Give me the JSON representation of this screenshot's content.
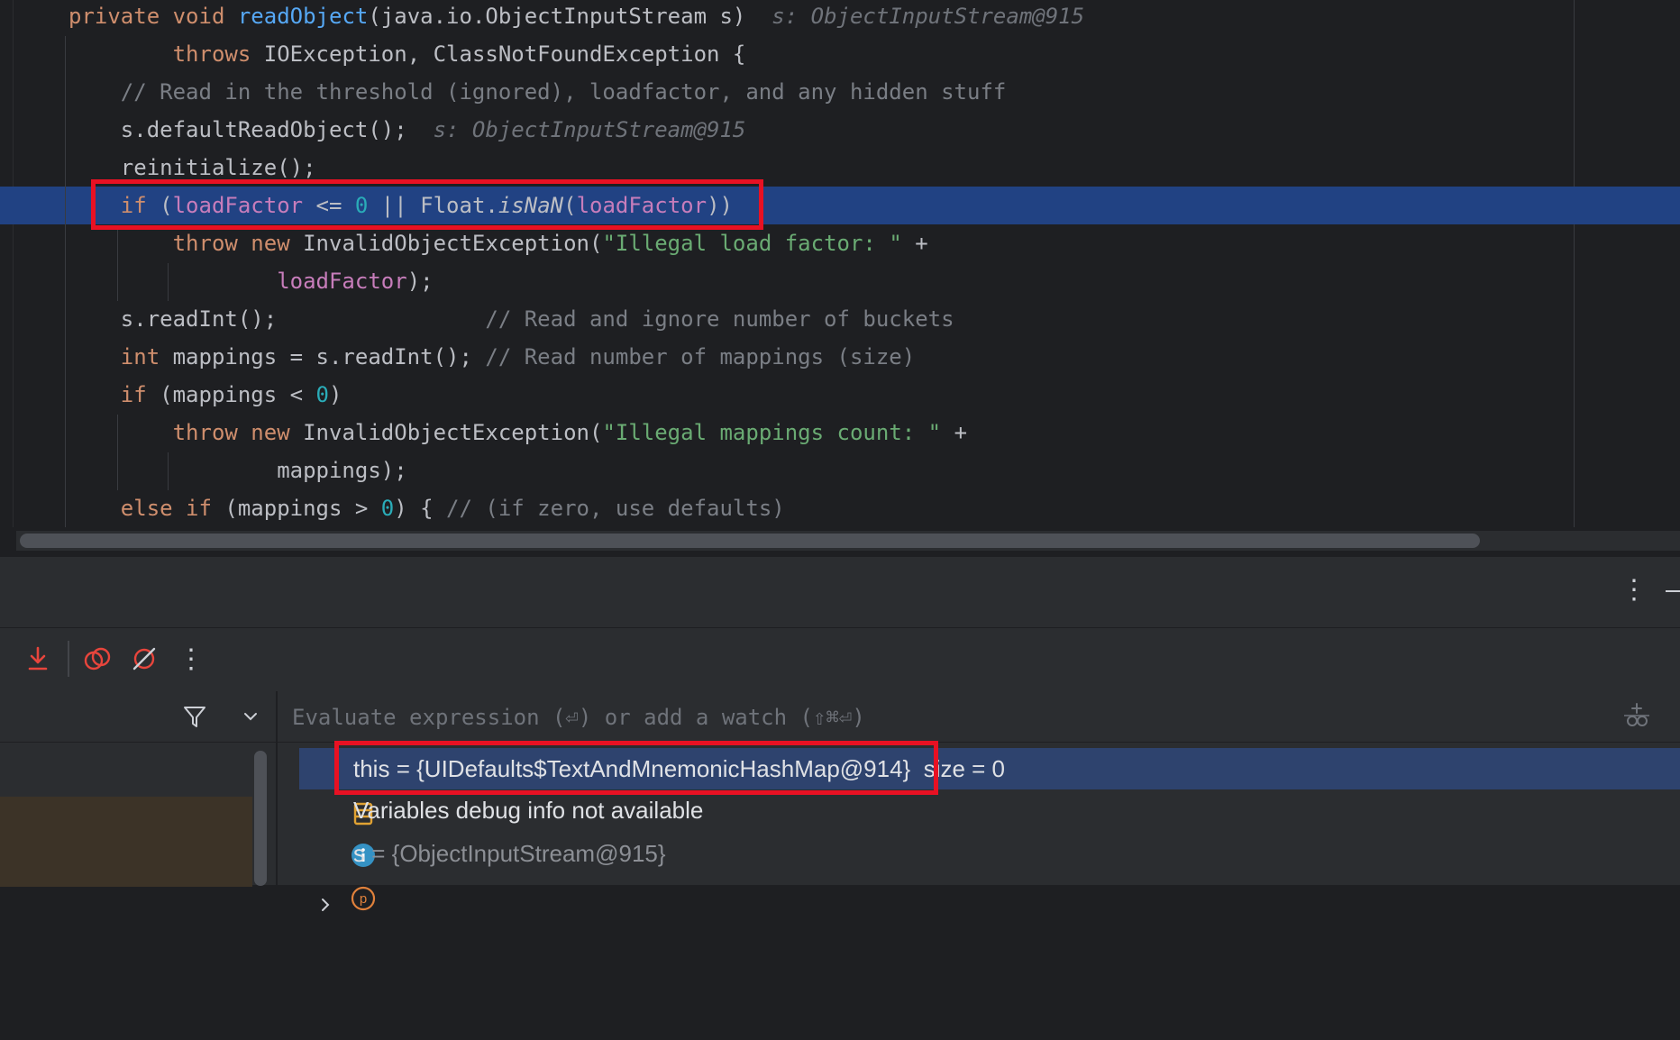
{
  "editor": {
    "lines": [
      {
        "segments": [
          {
            "t": "private void ",
            "c": "kw"
          },
          {
            "t": "readObject",
            "c": "fn"
          },
          {
            "t": "(java.io.ObjectInputStream s)  ",
            "c": ""
          },
          {
            "t": "s: ObjectInputStream@915",
            "c": "hint"
          }
        ]
      },
      {
        "segments": [
          {
            "t": "        throws ",
            "c": "kw"
          },
          {
            "t": "IOException, ClassNotFoundException {",
            "c": ""
          }
        ]
      },
      {
        "segments": [
          {
            "t": "    // Read in the threshold (ignored), loadfactor, and any hidden stuff",
            "c": "cm"
          }
        ]
      },
      {
        "segments": [
          {
            "t": "    s.defaultReadObject();  ",
            "c": ""
          },
          {
            "t": "s: ObjectInputStream@915",
            "c": "hint"
          }
        ]
      },
      {
        "segments": [
          {
            "t": "    reinitialize();",
            "c": ""
          }
        ]
      },
      {
        "segments": [
          {
            "t": "    if ",
            "c": "kw"
          },
          {
            "t": "(",
            "c": ""
          },
          {
            "t": "loadFactor",
            "c": "fld"
          },
          {
            "t": " <= ",
            "c": ""
          },
          {
            "t": "0",
            "c": "num"
          },
          {
            "t": " || Float.",
            "c": ""
          },
          {
            "t": "isNaN",
            "c": "stat"
          },
          {
            "t": "(",
            "c": ""
          },
          {
            "t": "loadFactor",
            "c": "fld"
          },
          {
            "t": "))",
            "c": ""
          }
        ]
      },
      {
        "segments": [
          {
            "t": "        throw new ",
            "c": "kw"
          },
          {
            "t": "InvalidObjectException(",
            "c": ""
          },
          {
            "t": "\"Illegal load factor: \"",
            "c": "str"
          },
          {
            "t": " +",
            "c": ""
          }
        ]
      },
      {
        "segments": [
          {
            "t": "                ",
            "c": ""
          },
          {
            "t": "loadFactor",
            "c": "fld"
          },
          {
            "t": ");",
            "c": ""
          }
        ]
      },
      {
        "segments": [
          {
            "t": "    s.readInt();                ",
            "c": ""
          },
          {
            "t": "// Read and ignore number of buckets",
            "c": "cm"
          }
        ]
      },
      {
        "segments": [
          {
            "t": "    int ",
            "c": "kw"
          },
          {
            "t": "mappings = s.readInt(); ",
            "c": ""
          },
          {
            "t": "// Read number of mappings (size)",
            "c": "cm"
          }
        ]
      },
      {
        "segments": [
          {
            "t": "    if ",
            "c": "kw"
          },
          {
            "t": "(mappings < ",
            "c": ""
          },
          {
            "t": "0",
            "c": "num"
          },
          {
            "t": ")",
            "c": ""
          }
        ]
      },
      {
        "segments": [
          {
            "t": "        throw new ",
            "c": "kw"
          },
          {
            "t": "InvalidObjectException(",
            "c": ""
          },
          {
            "t": "\"Illegal mappings count: \"",
            "c": "str"
          },
          {
            "t": " +",
            "c": ""
          }
        ]
      },
      {
        "segments": [
          {
            "t": "                mappings);",
            "c": ""
          }
        ]
      },
      {
        "segments": [
          {
            "t": "    else if ",
            "c": "kw"
          },
          {
            "t": "(mappings > ",
            "c": ""
          },
          {
            "t": "0",
            "c": "num"
          },
          {
            "t": ") { ",
            "c": ""
          },
          {
            "t": "// (if zero, use defaults)",
            "c": "cm"
          }
        ]
      }
    ],
    "current_line_index": 5
  },
  "colors": {
    "current_line": "#214283",
    "highlight_box": "#e81123",
    "selected_var_row": "#2e436e"
  },
  "panel": {
    "more_icon": "more-vertical-icon",
    "minimize_icon": "minimize-icon"
  },
  "toolbar": {
    "icons": [
      "step-into-icon",
      "view-breakpoints-icon",
      "mute-breakpoints-icon",
      "more-vertical-icon"
    ]
  },
  "frames": {
    "icons": [
      "filter-icon",
      "chevron-down-icon"
    ]
  },
  "evaluate": {
    "placeholder": "Evaluate expression (⏎) or add a watch (⇧⌘⏎)",
    "add_watch_icon": "add-watch-icon"
  },
  "variables": [
    {
      "icon": "object-field-icon",
      "name": "this",
      "value": "= {UIDefaults$TextAndMnemonicHashMap@914}  size = 0",
      "selected": true
    },
    {
      "icon": "info-icon",
      "name": "Variables debug info not available",
      "value": "",
      "selected": false
    },
    {
      "icon": "parameter-icon",
      "name": "s",
      "value": " = {ObjectInputStream@915}",
      "selected": false,
      "expandable": true
    }
  ]
}
